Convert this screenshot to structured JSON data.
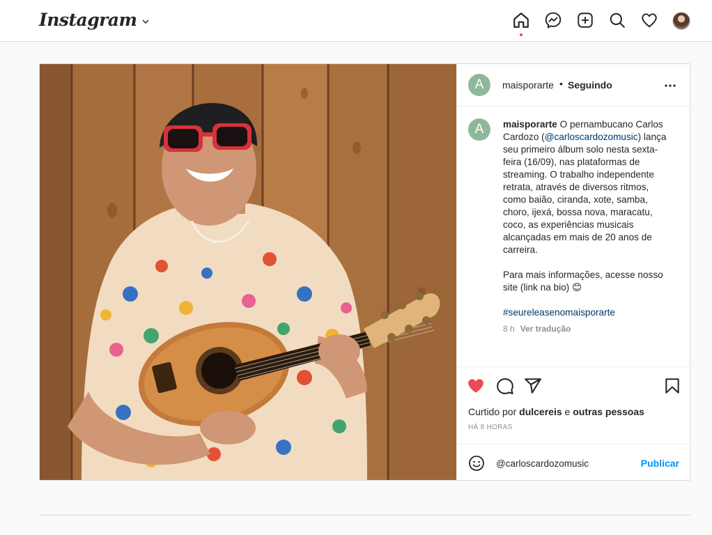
{
  "colors": {
    "accent_blue": "#0095f6",
    "like_red": "#ed4956",
    "avatar_green": "#8fb79a",
    "link_dark_blue": "#00376b",
    "muted_gray": "#8e8e8e"
  },
  "nav": {
    "logo_text": "Instagram",
    "icons": [
      "home-icon",
      "messenger-icon",
      "new-post-icon",
      "search-icon",
      "activity-heart-icon",
      "profile-avatar"
    ]
  },
  "post": {
    "author": {
      "avatar_letter": "A",
      "username": "maisporarte",
      "separator": "•",
      "follow_status": "Seguindo"
    },
    "caption": {
      "avatar_letter": "A",
      "username": "maisporarte",
      "text_1": " O pernambucano Carlos Cardozo (",
      "mention": "@carloscardozomusic",
      "text_2": ") lança seu primeiro álbum solo nesta sexta-feira (16/09), nas plataformas de streaming. O trabalho independente retrata, através de diversos ritmos, como baião, ciranda, xote, samba, choro, ijexá, bossa nova, maracatu, coco, as experiências musicais alcançadas em mais de 20 anos de carreira.",
      "paragraph_2": "Para mais informações, acesse nosso site (link na bio) 😊",
      "hashtag": "#seureleasenomaisporarte",
      "age": "8 h",
      "translate_label": "Ver tradução"
    },
    "likes": {
      "prefix": "Curtido por ",
      "user": "dulcereis",
      "joiner": " e ",
      "others": "outras pessoas"
    },
    "timestamp": "HÁ 8 HORAS",
    "comment": {
      "value": "@carloscardozomusic",
      "publish_label": "Publicar"
    }
  }
}
